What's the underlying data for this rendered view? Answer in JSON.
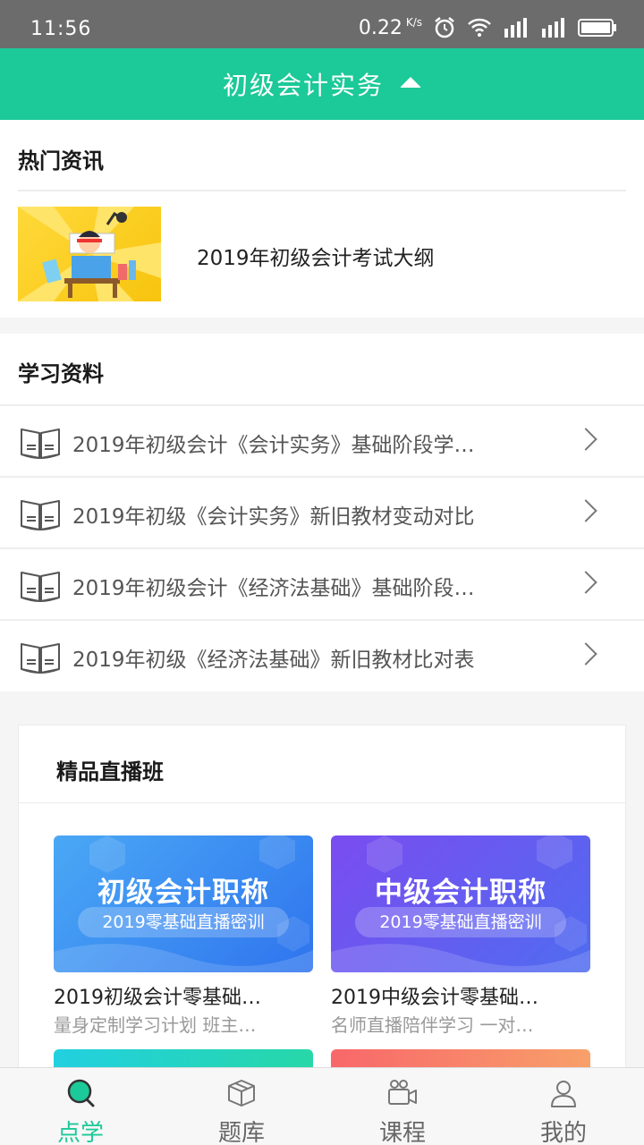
{
  "colors": {
    "accent": "#1cc998",
    "status_bar": "#6c6c6c"
  },
  "status_bar": {
    "time": "11:56",
    "speed": "0.22",
    "speed_unit": "K/s",
    "network1": "4G",
    "network2": "4G"
  },
  "header": {
    "title": "初级会计实务"
  },
  "news": {
    "section_title": "热门资讯",
    "items": [
      {
        "title": "2019年初级会计考试大纲"
      }
    ]
  },
  "materials": {
    "section_title": "学习资料",
    "items": [
      {
        "label": "2019年初级会计《会计实务》基础阶段学…"
      },
      {
        "label": "2019年初级《会计实务》新旧教材变动对比"
      },
      {
        "label": "2019年初级会计《经济法基础》基础阶段…"
      },
      {
        "label": "2019年初级《经济法基础》新旧教材比对表"
      }
    ]
  },
  "live": {
    "section_title": "精品直播班",
    "courses": [
      {
        "banner_title": "初级会计职称",
        "banner_sub": "2019零基础直播密训",
        "title": "2019初级会计零基础…",
        "subtitle": "量身定制学习计划  班主…"
      },
      {
        "banner_title": "中级会计职称",
        "banner_sub": "2019零基础直播密训",
        "title": "2019中级会计零基础…",
        "subtitle": "名师直播陪伴学习  一对…"
      }
    ]
  },
  "bottom_nav": {
    "items": [
      {
        "label": "点学",
        "icon": "search-icon",
        "active": true
      },
      {
        "label": "题库",
        "icon": "box-icon",
        "active": false
      },
      {
        "label": "课程",
        "icon": "video-camera-icon",
        "active": false
      },
      {
        "label": "我的",
        "icon": "user-icon",
        "active": false
      }
    ]
  }
}
